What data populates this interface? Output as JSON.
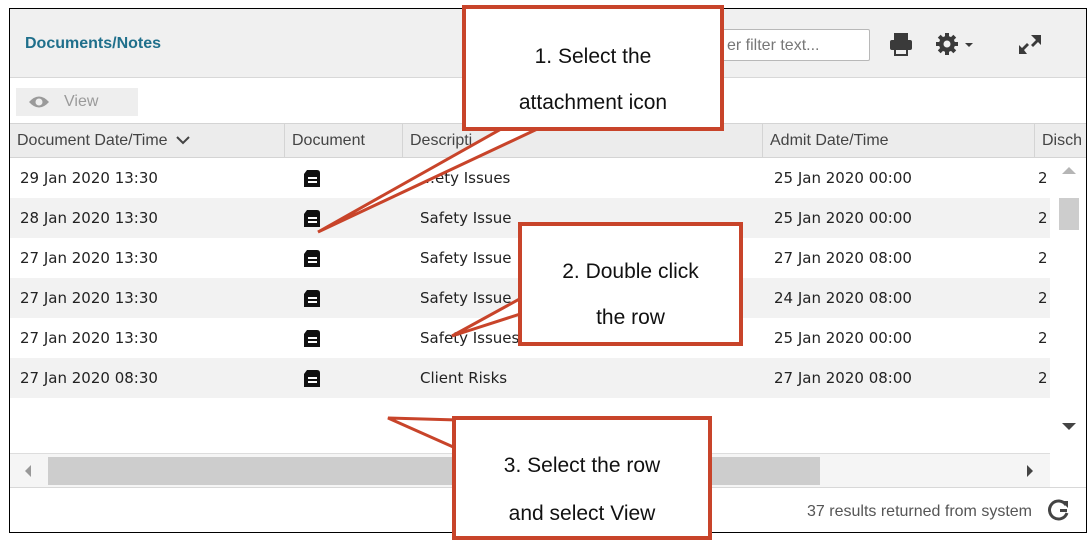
{
  "panel": {
    "title": "Documents/Notes",
    "filter_placeholder": "er filter text...",
    "view_label": "View",
    "results_text": "37 results returned from system"
  },
  "icons": {
    "print": "printer-icon",
    "settings": "gear-icon",
    "expand": "expand-icon",
    "view": "eye-icon",
    "document": "document-icon",
    "refresh": "refresh-icon",
    "sort": "chevron-down-icon"
  },
  "columns": [
    "Document Date/Time",
    "Document",
    "Descripti",
    "Admit Date/Time",
    "Disch"
  ],
  "rows": [
    {
      "date": "29 Jan 2020 13:30",
      "description": "…ety Issues",
      "admit": "25 Jan 2020 00:00",
      "disch": "2"
    },
    {
      "date": "28 Jan 2020 13:30",
      "description": "Safety Issue",
      "admit": "25 Jan 2020 00:00",
      "disch": "2"
    },
    {
      "date": "27 Jan 2020 13:30",
      "description": "Safety Issue",
      "admit": "27 Jan 2020 08:00",
      "disch": "2"
    },
    {
      "date": "27 Jan 2020 13:30",
      "description": "Safety Issue",
      "admit": "24 Jan 2020 08:00",
      "disch": "2"
    },
    {
      "date": "27 Jan 2020 13:30",
      "description": "Safety Issues",
      "admit": "25 Jan 2020 00:00",
      "disch": "2"
    },
    {
      "date": "27 Jan 2020 08:30",
      "description": "Client Risks",
      "admit": "27 Jan 2020 08:00",
      "disch": "2"
    }
  ],
  "callouts": {
    "c1": [
      "1. Select the",
      "attachment icon"
    ],
    "c2": [
      "2. Double click",
      "the row"
    ],
    "c3": [
      "3. Select the row",
      "and select View"
    ]
  },
  "colors": {
    "accent": "#1f6f8b",
    "callout_border": "#c8442a",
    "row_alt": "#f2f2f2"
  }
}
